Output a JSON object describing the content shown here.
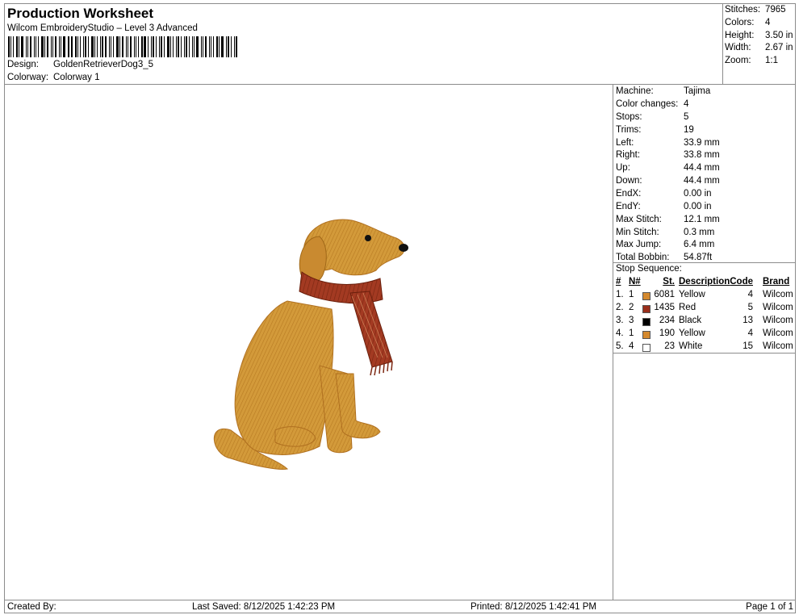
{
  "header": {
    "title": "Production Worksheet",
    "subtitle": "Wilcom EmbroideryStudio – Level 3 Advanced",
    "design_label": "Design:",
    "design_value": "GoldenRetrieverDog3_5",
    "colorway_label": "Colorway:",
    "colorway_value": "Colorway 1"
  },
  "summary": {
    "stitches_label": "Stitches:",
    "stitches": "7965",
    "colors_label": "Colors:",
    "colors": "4",
    "height_label": "Height:",
    "height": "3.50 in",
    "width_label": "Width:",
    "width": "2.67 in",
    "zoom_label": "Zoom:",
    "zoom": "1:1"
  },
  "info": {
    "machine_label": "Machine:",
    "machine": "Tajima",
    "color_changes_label": "Color changes:",
    "color_changes": "4",
    "stops_label": "Stops:",
    "stops": "5",
    "trims_label": "Trims:",
    "trims": "19",
    "left_label": "Left:",
    "left": "33.9 mm",
    "right_label": "Right:",
    "right": "33.8 mm",
    "up_label": "Up:",
    "up": "44.4 mm",
    "down_label": "Down:",
    "down": "44.4 mm",
    "endx_label": "EndX:",
    "endx": "0.00 in",
    "endy_label": "EndY:",
    "endy": "0.00 in",
    "max_stitch_label": "Max Stitch:",
    "max_stitch": "12.1 mm",
    "min_stitch_label": "Min Stitch:",
    "min_stitch": "0.3 mm",
    "max_jump_label": "Max Jump:",
    "max_jump": "6.4 mm",
    "total_bobbin_label": "Total Bobbin:",
    "total_bobbin": "54.87ft"
  },
  "stop_sequence": {
    "title": "Stop Sequence:",
    "headers": {
      "idx": "#",
      "n": "N#",
      "st": "St.",
      "desc": "Description",
      "code": "Code",
      "brand": "Brand"
    },
    "rows": [
      {
        "idx": "1.",
        "n": "1",
        "color": "#d4892e",
        "st": "6081",
        "desc": "Yellow",
        "code": "4",
        "brand": "Wilcom"
      },
      {
        "idx": "2.",
        "n": "2",
        "color": "#9a2f1c",
        "st": "1435",
        "desc": "Red",
        "code": "5",
        "brand": "Wilcom"
      },
      {
        "idx": "3.",
        "n": "3",
        "color": "#000000",
        "st": "234",
        "desc": "Black",
        "code": "13",
        "brand": "Wilcom"
      },
      {
        "idx": "4.",
        "n": "1",
        "color": "#d4892e",
        "st": "190",
        "desc": "Yellow",
        "code": "4",
        "brand": "Wilcom"
      },
      {
        "idx": "5.",
        "n": "4",
        "color": "#ffffff",
        "st": "23",
        "desc": "White",
        "code": "15",
        "brand": "Wilcom"
      }
    ]
  },
  "footer": {
    "created_by": "Created By:",
    "last_saved": "Last Saved: 8/12/2025 1:42:23 PM",
    "printed": "Printed: 8/12/2025 1:42:41 PM",
    "page": "Page 1 of 1"
  }
}
